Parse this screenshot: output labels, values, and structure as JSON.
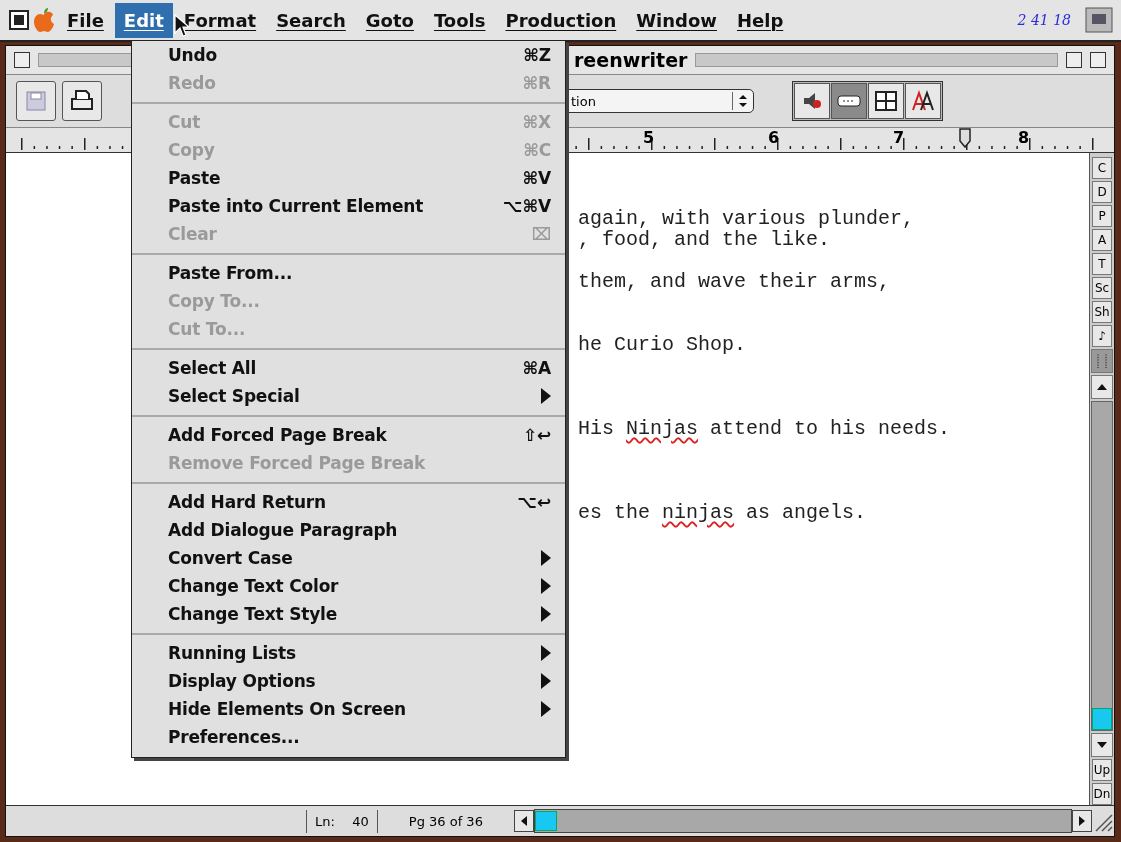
{
  "menu_bar": {
    "items": [
      {
        "label": "File",
        "selected": false
      },
      {
        "label": "Edit",
        "selected": true
      },
      {
        "label": "Format",
        "selected": false
      },
      {
        "label": "Search",
        "selected": false
      },
      {
        "label": "Goto",
        "selected": false
      },
      {
        "label": "Tools",
        "selected": false
      },
      {
        "label": "Production",
        "selected": false
      },
      {
        "label": "Window",
        "selected": false
      },
      {
        "label": "Help",
        "selected": false
      }
    ],
    "clock": "2 41 18"
  },
  "edit_menu": [
    {
      "kind": "item",
      "label": "Undo",
      "shortcut": "⌘Z",
      "disabled": false,
      "submenu": false
    },
    {
      "kind": "item",
      "label": "Redo",
      "shortcut": "⌘R",
      "disabled": true,
      "submenu": false
    },
    {
      "kind": "separator"
    },
    {
      "kind": "item",
      "label": "Cut",
      "shortcut": "⌘X",
      "disabled": true,
      "submenu": false
    },
    {
      "kind": "item",
      "label": "Copy",
      "shortcut": "⌘C",
      "disabled": true,
      "submenu": false
    },
    {
      "kind": "item",
      "label": "Paste",
      "shortcut": "⌘V",
      "disabled": false,
      "submenu": false
    },
    {
      "kind": "item",
      "label": "Paste into Current Element",
      "shortcut": "⌥⌘V",
      "disabled": false,
      "submenu": false
    },
    {
      "kind": "item",
      "label": "Clear",
      "shortcut": "⌧",
      "disabled": true,
      "submenu": false
    },
    {
      "kind": "separator"
    },
    {
      "kind": "item",
      "label": "Paste From...",
      "disabled": false,
      "submenu": false
    },
    {
      "kind": "item",
      "label": "Copy To...",
      "disabled": true,
      "submenu": false
    },
    {
      "kind": "item",
      "label": "Cut To...",
      "disabled": true,
      "submenu": false
    },
    {
      "kind": "separator"
    },
    {
      "kind": "item",
      "label": "Select All",
      "shortcut": "⌘A",
      "disabled": false,
      "submenu": false
    },
    {
      "kind": "item",
      "label": "Select Special",
      "disabled": false,
      "submenu": true
    },
    {
      "kind": "separator"
    },
    {
      "kind": "item",
      "label": "Add Forced Page Break",
      "shortcut": "⇧↩",
      "disabled": false,
      "submenu": false
    },
    {
      "kind": "item",
      "label": "Remove Forced Page Break",
      "disabled": true,
      "submenu": false
    },
    {
      "kind": "separator"
    },
    {
      "kind": "item",
      "label": "Add Hard Return",
      "shortcut": "⌥↩",
      "disabled": false,
      "submenu": false
    },
    {
      "kind": "item",
      "label": "Add Dialogue Paragraph",
      "disabled": false,
      "submenu": false
    },
    {
      "kind": "item",
      "label": "Convert Case",
      "disabled": false,
      "submenu": true
    },
    {
      "kind": "item",
      "label": "Change Text Color",
      "disabled": false,
      "submenu": true
    },
    {
      "kind": "item",
      "label": "Change Text Style",
      "disabled": false,
      "submenu": true
    },
    {
      "kind": "separator"
    },
    {
      "kind": "item",
      "label": "Running Lists",
      "disabled": false,
      "submenu": true
    },
    {
      "kind": "item",
      "label": "Display Options",
      "disabled": false,
      "submenu": true
    },
    {
      "kind": "item",
      "label": "Hide Elements On Screen",
      "disabled": false,
      "submenu": true
    },
    {
      "kind": "item",
      "label": "Preferences...",
      "disabled": false,
      "submenu": false
    }
  ],
  "window": {
    "title": "reenwriter",
    "toolbar": {
      "element_popup": "tion",
      "view_buttons": [
        {
          "selected": false
        },
        {
          "selected": true
        },
        {
          "selected": false
        },
        {
          "selected": false
        }
      ]
    },
    "ruler": {
      "numbers": [
        "5",
        "6",
        "7",
        "8"
      ]
    },
    "document": {
      "lines": [
        [
          {
            "text": "again, with various plunder,",
            "misspelled": false
          }
        ],
        [
          {
            "text": ", food, and the like.",
            "misspelled": false
          }
        ],
        [
          {
            "text": "them, and wave their arms,",
            "misspelled": false
          }
        ],
        [
          {
            "text": "he Curio Shop.",
            "misspelled": false
          }
        ],
        [
          {
            "text": "His ",
            "misspelled": false
          },
          {
            "text": "Ninjas",
            "misspelled": true
          },
          {
            "text": " attend to his needs.",
            "misspelled": false
          }
        ],
        [
          {
            "text": "es the ",
            "misspelled": false
          },
          {
            "text": "ninjas",
            "misspelled": true
          },
          {
            "text": " as angels.",
            "misspelled": false
          }
        ]
      ]
    },
    "element_buttons": [
      "C",
      "D",
      "P",
      "A",
      "T",
      "Sc",
      "Sh",
      "♪"
    ],
    "page_buttons": [
      "Up",
      "Dn"
    ],
    "status_bar": {
      "line_label": "Ln:",
      "line": "40",
      "page": "Pg 36 of 36"
    }
  }
}
